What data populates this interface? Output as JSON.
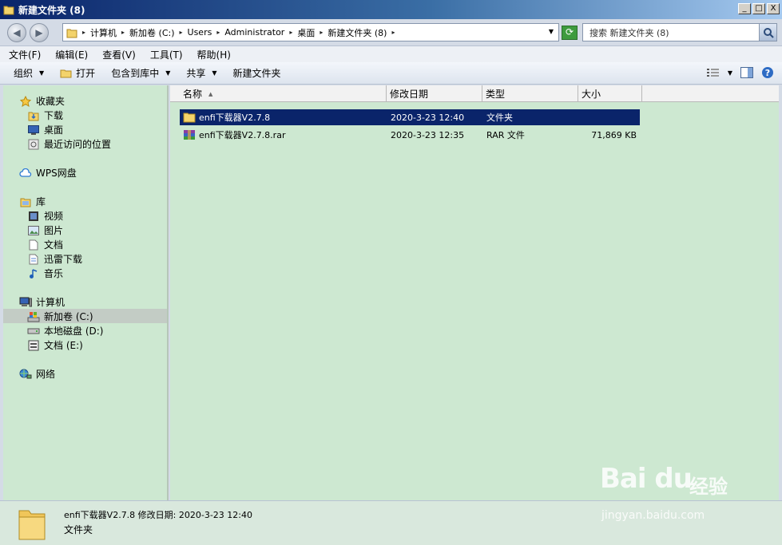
{
  "window": {
    "title": "新建文件夹 (8)",
    "buttons": [
      "_",
      "□",
      "X"
    ]
  },
  "address": {
    "crumbs": [
      "计算机",
      "新加卷 (C:)",
      "Users",
      "Administrator",
      "桌面",
      "新建文件夹 (8)"
    ],
    "search_placeholder": "搜索 新建文件夹 (8)"
  },
  "menu": [
    "文件(F)",
    "编辑(E)",
    "查看(V)",
    "工具(T)",
    "帮助(H)"
  ],
  "toolbar": {
    "organize": "组织",
    "open": "打开",
    "include_library": "包含到库中",
    "share": "共享",
    "new_folder": "新建文件夹"
  },
  "nav": {
    "favorites": "收藏夹",
    "downloads": "下载",
    "desktop": "桌面",
    "recent": "最近访问的位置",
    "wps": "WPS网盘",
    "libraries": "库",
    "videos": "视频",
    "pictures": "图片",
    "documents": "文档",
    "thunder": "迅雷下载",
    "music": "音乐",
    "computer": "计算机",
    "drive_c": "新加卷 (C:)",
    "drive_d": "本地磁盘 (D:)",
    "drive_e": "文档 (E:)",
    "network": "网络"
  },
  "columns": {
    "name": "名称",
    "modified": "修改日期",
    "type": "类型",
    "size": "大小"
  },
  "files": [
    {
      "name": "enfi下载器V2.7.8",
      "modified": "2020-3-23 12:40",
      "type": "文件夹",
      "size": ""
    },
    {
      "name": "enfi下载器V2.7.8.rar",
      "modified": "2020-3-23 12:35",
      "type": "RAR 文件",
      "size": "71,869 KB"
    }
  ],
  "details": {
    "line1": "enfi下载器V2.7.8  修改日期: 2020-3-23 12:40",
    "line2": "文件夹"
  },
  "watermark": {
    "brand": "Bai du",
    "text": "经验",
    "url": "jingyan.baidu.com"
  },
  "colors": {
    "title_bar": "#0a246a",
    "content_bg": "#cde8d1",
    "selection": "#0a246a"
  }
}
